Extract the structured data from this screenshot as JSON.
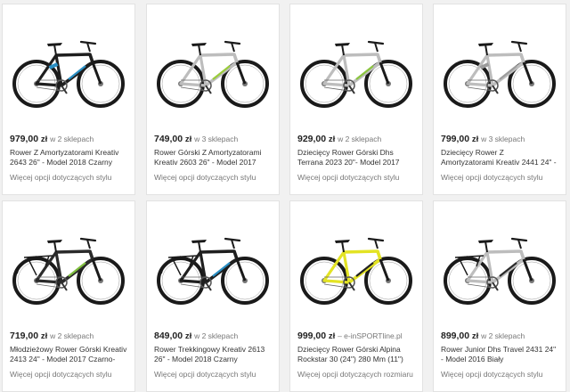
{
  "products": [
    {
      "price": "979,00",
      "currency": "zł",
      "stores": "w 2 sklepach",
      "title": "Rower Z Amortyzatorami Kreativ 2643 26\" - Model 2018 Czarny",
      "more": "Więcej opcji dotyczących stylu",
      "frame_color": "#1e1e1e",
      "accent": "#2a8fc4",
      "style": "mtb-full"
    },
    {
      "price": "749,00",
      "currency": "zł",
      "stores": "w 3 sklepach",
      "title": "Rower Górski Z Amortyzatorami Kreativ 2603 26\" - Model 2017 Biały",
      "more": "Więcej opcji dotyczących stylu",
      "frame_color": "#e9e9e9",
      "accent": "#9acc3a",
      "style": "mtb"
    },
    {
      "price": "929,00",
      "currency": "zł",
      "stores": "w 2 sklepach",
      "title": "Dziecięcy Rower Górski Dhs Terrana 2023 20\"- Model 2017 Biały",
      "more": "Więcej opcji dotyczących stylu",
      "frame_color": "#e6e6e6",
      "accent": "#8bc53f",
      "style": "mtb"
    },
    {
      "price": "799,00",
      "currency": "zł",
      "stores": "w 3 sklepach",
      "title": "Dziecięcy Rower Z Amortyzatorami Kreativ 2441 24\" - Model 2017 Biały",
      "more": "Więcej opcji dotyczących stylu",
      "frame_color": "#e4e4e4",
      "accent": "#9c9c9c",
      "style": "mtb-full"
    },
    {
      "price": "719,00",
      "currency": "zł",
      "stores": "w 2 sklepach",
      "title": "Młodzieżowy Rower Górski Kreativ 2413 24\" - Model 2017 Czarno-Zielony",
      "more": "Więcej opcji dotyczących stylu",
      "frame_color": "#2b2b2b",
      "accent": "#7fbf3f",
      "style": "trekking"
    },
    {
      "price": "849,00",
      "currency": "zł",
      "stores": "w 2 sklepach",
      "title": "Rower Trekkingowy Kreativ 2613 26\" - Model 2018 Czarny",
      "more": "Więcej opcji dotyczących stylu",
      "frame_color": "#1f1f1f",
      "accent": "#2a8fc4",
      "style": "trekking"
    },
    {
      "price": "999,00",
      "currency": "zł",
      "stores": "– e-inSPORTline.pl",
      "title": "Dziecięcy Rower Górski Alpina Rockstar 30 (24\") 280 Mm (11\")",
      "more": "Więcej opcji dotyczących rozmiaru",
      "frame_color": "#e3e324",
      "accent": "#222222",
      "style": "mtb"
    },
    {
      "price": "899,00",
      "currency": "zł",
      "stores": "w 2 sklepach",
      "title": "Rower Junior Dhs Travel 2431 24\" - Model 2016 Biały",
      "more": "Więcej opcji dotyczących stylu",
      "frame_color": "#dcdcdc",
      "accent": "#2a2a2a",
      "style": "trekking"
    }
  ]
}
